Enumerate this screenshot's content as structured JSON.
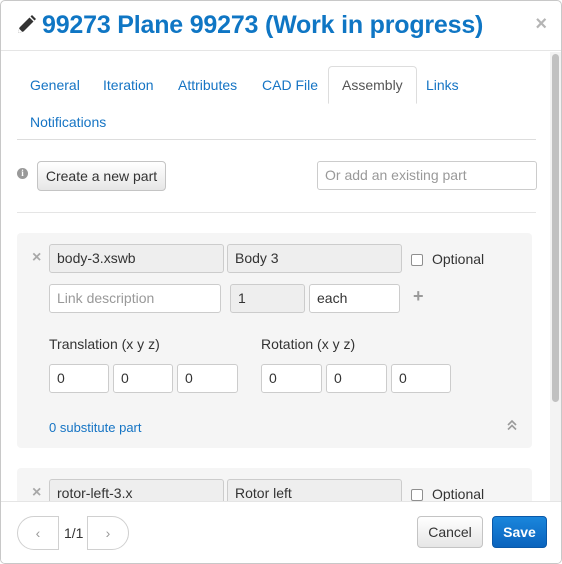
{
  "header": {
    "title": "99273 Plane 99273 (Work in progress)",
    "edit_icon": "pencil-icon",
    "close_label": "×"
  },
  "tabs": [
    {
      "label": "General",
      "active": false
    },
    {
      "label": "Iteration",
      "active": false
    },
    {
      "label": "Attributes",
      "active": false
    },
    {
      "label": "CAD File",
      "active": false
    },
    {
      "label": "Assembly",
      "active": true
    },
    {
      "label": "Links",
      "active": false
    },
    {
      "label": "Notifications",
      "active": false
    }
  ],
  "toolbar": {
    "info_icon": "info-icon",
    "create_part_label": "Create a new part",
    "existing_part_placeholder": "Or add an existing part"
  },
  "parts": [
    {
      "remove_label": "×",
      "file_name": "body-3.xswb",
      "name": "Body 3",
      "optional_label": "Optional",
      "optional_checked": false,
      "link_description_placeholder": "Link description",
      "quantity": "1",
      "unit": "each",
      "add_label": "+",
      "translation_label": "Translation (x y z)",
      "translation": [
        "0",
        "0",
        "0"
      ],
      "rotation_label": "Rotation (x y z)",
      "rotation": [
        "0",
        "0",
        "0"
      ],
      "substitute_label": "0 substitute part",
      "collapse_icon": "chevron-double-up-icon"
    },
    {
      "remove_label": "×",
      "file_name": "rotor-left-3.x",
      "name": "Rotor left",
      "optional_label": "Optional",
      "optional_checked": false
    }
  ],
  "footer": {
    "prev_label": "‹",
    "page_indicator": "1/1",
    "next_label": "›",
    "cancel_label": "Cancel",
    "save_label": "Save"
  },
  "colors": {
    "accent": "#0f76c4",
    "link": "#1574c4",
    "primary_button": "#0a63bd"
  }
}
